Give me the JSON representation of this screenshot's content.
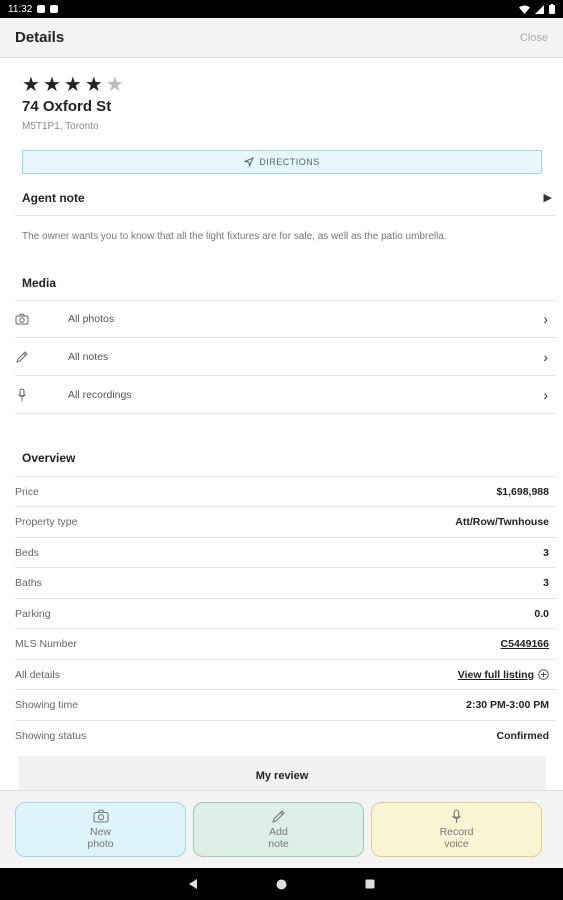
{
  "status_bar": {
    "time": "11:32"
  },
  "header": {
    "title": "Details",
    "close_label": "Close"
  },
  "rating": {
    "value": 4,
    "max": 5
  },
  "listing": {
    "address": "74 Oxford St",
    "city": "M5T1P1, Toronto"
  },
  "directions_label": "DIRECTIONS",
  "agent_note": {
    "title": "Agent note",
    "text": "The owner wants you to know that all the light fixtures are for sale, as well as the patio umbrella."
  },
  "media": {
    "title": "Media",
    "items": [
      {
        "label": "All photos",
        "icon": "camera-icon"
      },
      {
        "label": "All notes",
        "icon": "pencil-icon"
      },
      {
        "label": "All recordings",
        "icon": "microphone-icon"
      }
    ]
  },
  "overview": {
    "title": "Overview",
    "rows": [
      {
        "key": "Price",
        "value": "$1,698,988"
      },
      {
        "key": "Property type",
        "value": "Att/Row/Twnhouse"
      },
      {
        "key": "Beds",
        "value": "3"
      },
      {
        "key": "Baths",
        "value": "3"
      },
      {
        "key": "Parking",
        "value": "0.0"
      },
      {
        "key": "MLS Number",
        "value": "C5449166"
      },
      {
        "key": "All details",
        "value": "View full listing"
      },
      {
        "key": "Showing time",
        "value": "2:30 PM-3:00 PM"
      },
      {
        "key": "Showing status",
        "value": "Confirmed"
      }
    ]
  },
  "review_label": "My review",
  "actions": {
    "new_photo": {
      "line1": "New",
      "line2": "photo"
    },
    "add_note": {
      "line1": "Add",
      "line2": "note"
    },
    "record_voice": {
      "line1": "Record",
      "line2": "voice"
    }
  },
  "colors": {
    "photo_bg": "#dcf4fa",
    "note_bg": "#dcefe6",
    "voice_bg": "#fbf4d3",
    "directions_bg": "#e6f6fa"
  }
}
